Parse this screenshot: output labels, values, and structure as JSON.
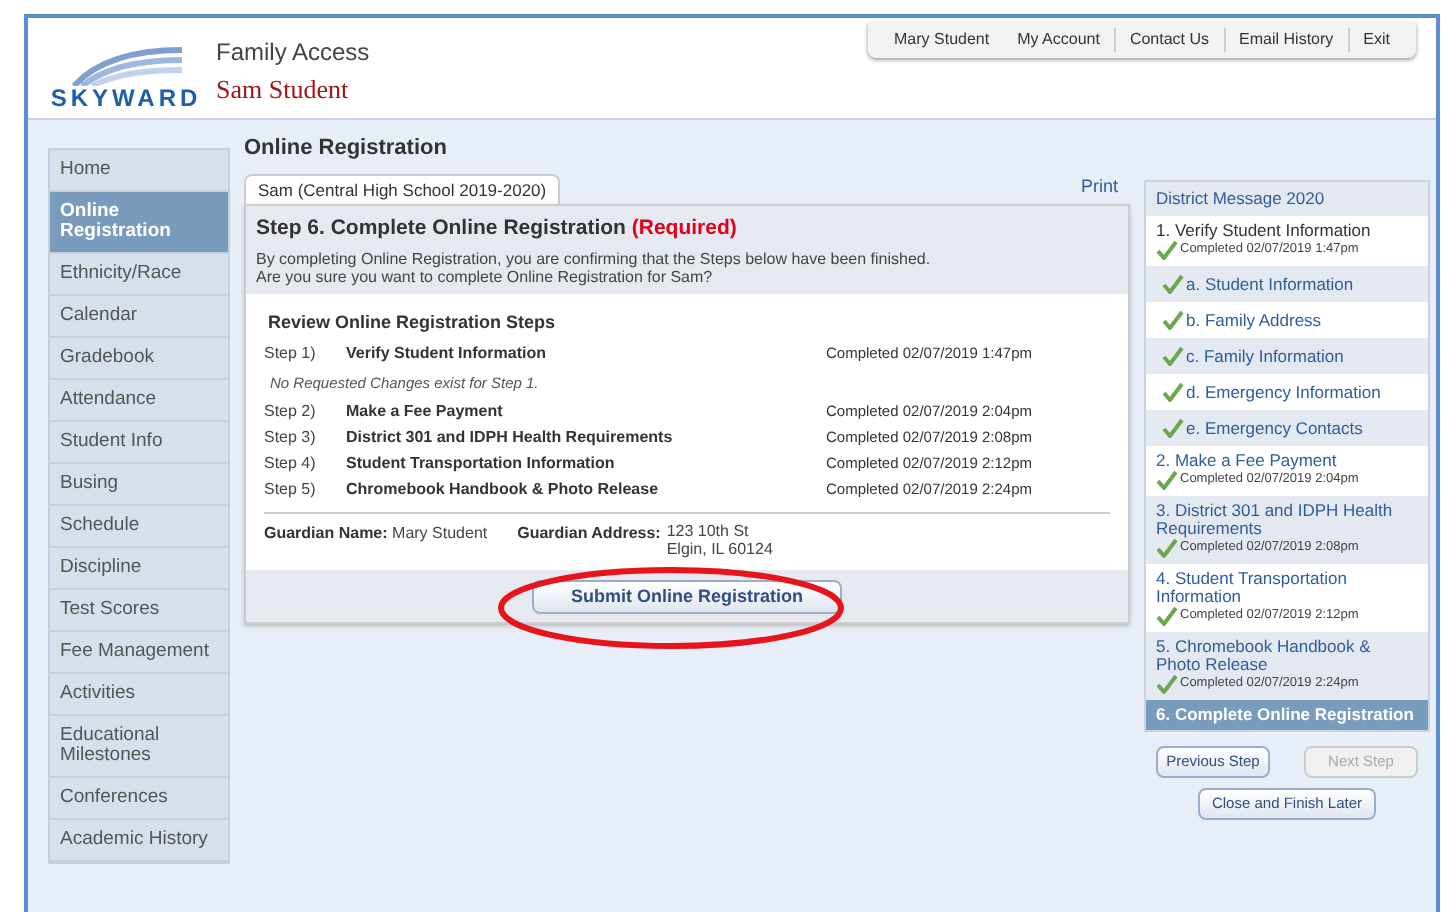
{
  "header": {
    "logo": "SKYWARD",
    "app_title": "Family Access",
    "student_name": "Sam Student"
  },
  "top_links": [
    {
      "label": "Mary Student"
    },
    {
      "label": "My Account"
    },
    {
      "label": "Contact Us"
    },
    {
      "label": "Email History"
    },
    {
      "label": "Exit"
    }
  ],
  "sidebar": {
    "items": [
      {
        "label": "Home",
        "selected": false
      },
      {
        "label": "Online Registration",
        "selected": true
      },
      {
        "label": "Ethnicity/Race",
        "selected": false
      },
      {
        "label": "Calendar",
        "selected": false
      },
      {
        "label": "Gradebook",
        "selected": false
      },
      {
        "label": "Attendance",
        "selected": false
      },
      {
        "label": "Student Info",
        "selected": false
      },
      {
        "label": "Busing",
        "selected": false
      },
      {
        "label": "Schedule",
        "selected": false
      },
      {
        "label": "Discipline",
        "selected": false
      },
      {
        "label": "Test Scores",
        "selected": false
      },
      {
        "label": "Fee Management",
        "selected": false
      },
      {
        "label": "Activities",
        "selected": false
      },
      {
        "label": "Educational Milestones",
        "selected": false
      },
      {
        "label": "Conferences",
        "selected": false
      },
      {
        "label": "Academic History",
        "selected": false
      }
    ]
  },
  "page_title": "Online Registration",
  "tabs": [
    {
      "label": "Sam (Central High School 2019-2020)",
      "selected": true
    }
  ],
  "print_link": "Print",
  "step_panel": {
    "title": "Step 6. Complete Online Registration",
    "required": "(Required)",
    "intro": "By completing Online Registration, you are confirming that the Steps below have been finished.",
    "question": "Are you sure you want to complete Online Registration for Sam?",
    "review_title": "Review Online Registration Steps",
    "rows": [
      {
        "kind": "step",
        "number": "Step 1)",
        "name": "Verify Student Information",
        "status": "Completed 02/07/2019 1:47pm"
      },
      {
        "kind": "note",
        "text": "No Requested Changes exist for Step 1."
      },
      {
        "kind": "step",
        "number": "Step 2)",
        "name": "Make a Fee Payment",
        "status": "Completed 02/07/2019 2:04pm"
      },
      {
        "kind": "step",
        "number": "Step 3)",
        "name": "District 301 and IDPH Health Requirements",
        "status": "Completed 02/07/2019 2:08pm"
      },
      {
        "kind": "step",
        "number": "Step 4)",
        "name": "Student Transportation Information",
        "status": "Completed 02/07/2019 2:12pm"
      },
      {
        "kind": "step",
        "number": "Step 5)",
        "name": "Chromebook Handbook & Photo Release",
        "status": "Completed 02/07/2019 2:24pm"
      }
    ],
    "guardian_name_label": "Guardian Name:",
    "guardian_name": "Mary Student",
    "guardian_address_label": "Guardian Address:",
    "guardian_address_lines": [
      "123 10th St",
      "Elgin, IL 60124"
    ],
    "submit_button": "Submit Online Registration"
  },
  "steps_nav": {
    "title": "District Message 2020",
    "items": [
      {
        "kind": "step",
        "label": "1. Verify Student Information",
        "status": "Completed 02/07/2019 1:47pm",
        "selected": false
      },
      {
        "kind": "substep",
        "label": "a. Student Information",
        "selected": false
      },
      {
        "kind": "substep",
        "label": "b. Family Address",
        "selected": false
      },
      {
        "kind": "substep",
        "label": "c. Family Information",
        "selected": false
      },
      {
        "kind": "substep",
        "label": "d. Emergency Information",
        "selected": false
      },
      {
        "kind": "substep",
        "label": "e. Emergency Contacts",
        "selected": false
      },
      {
        "kind": "step",
        "label": "2. Make a Fee Payment",
        "status": "Completed 02/07/2019 2:04pm",
        "selected": false
      },
      {
        "kind": "step",
        "label": "3. District 301 and IDPH Health Requirements",
        "status": "Completed 02/07/2019 2:08pm",
        "selected": false
      },
      {
        "kind": "step",
        "label": "4. Student Transportation Information",
        "status": "Completed 02/07/2019 2:12pm",
        "selected": false
      },
      {
        "kind": "step",
        "label": "5. Chromebook Handbook & Photo Release",
        "status": "Completed 02/07/2019 2:24pm",
        "selected": false
      },
      {
        "kind": "step",
        "label": "6. Complete Online Registration",
        "selected": true
      }
    ],
    "buttons": [
      {
        "label": "Previous Step",
        "disabled": false
      },
      {
        "label": "Next Step",
        "disabled": true
      },
      {
        "label": "Close and Finish Later",
        "disabled": false
      }
    ]
  }
}
